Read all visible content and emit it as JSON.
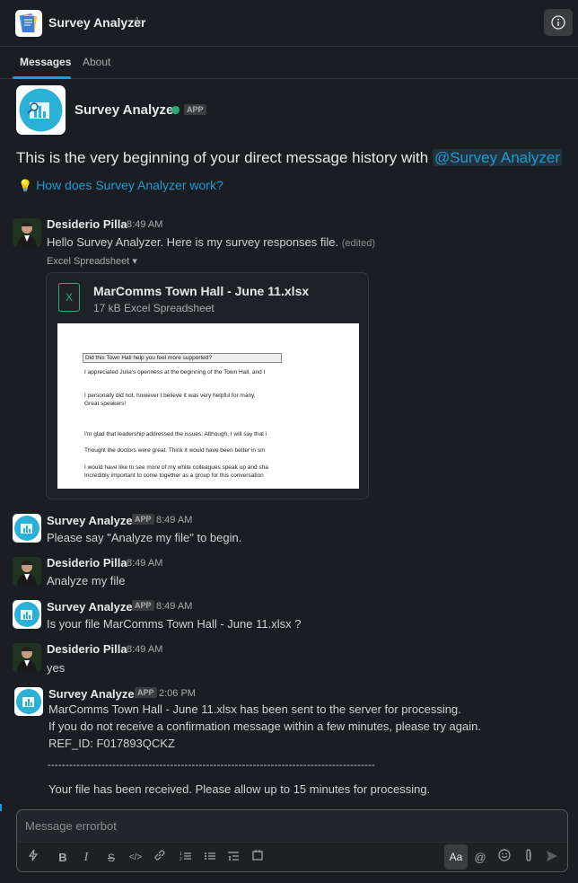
{
  "header": {
    "title": "Survey Analyzer",
    "star_icon": "star-icon",
    "info_icon": "info-icon"
  },
  "tabs": [
    {
      "label": "Messages",
      "active": true
    },
    {
      "label": "About",
      "active": false
    }
  ],
  "intro": {
    "name": "Survey Analyzer",
    "badge": "APP",
    "text_prefix": "This is the very beginning of your direct message history with ",
    "mention": "@Survey Analyzer",
    "howto": "How does Survey Analyzer work?"
  },
  "messages": [
    {
      "author": "Desiderio Pilla",
      "time": "8:49 AM",
      "text": "Hello Survey Analyzer. Here is my survey responses file.",
      "edited": "(edited)",
      "attachment_label": "Excel Spreadsheet",
      "file": {
        "name": "MarComms Town Hall - June 11.xlsx",
        "meta": "17 kB Excel Spreadsheet",
        "icon_letter": "X",
        "preview_rows": [
          "Did this Town Hall help you feel more supported?",
          "I appreciated Julia's openness at the beginning of the Town Hall, and I",
          "I personally did not, however I believe it was very helpful for many.",
          "Great speakers!",
          "I'm glad that leadership addressed the issues. Although, I will say that i",
          "Thought the doctors were great.  Think it would have been better in sm",
          "I would have like to see more of my white colleagues speak up and sha",
          "Incredibly important to come together as a group for this conversation"
        ]
      }
    },
    {
      "author": "Survey Analyzer",
      "badge": "APP",
      "time": "8:49 AM",
      "text": "Please say \"Analyze my file\" to begin."
    },
    {
      "author": "Desiderio Pilla",
      "time": "8:49 AM",
      "text": "Analyze my file"
    },
    {
      "author": "Survey Analyzer",
      "badge": "APP",
      "time": "8:49 AM",
      "text": "Is your file MarComms Town Hall - June 11.xlsx ?"
    },
    {
      "author": "Desiderio Pilla",
      "time": "8:49 AM",
      "text": "yes"
    },
    {
      "author": "Survey Analyzer",
      "badge": "APP",
      "time": "2:06 PM",
      "lines": [
        "MarComms Town Hall - June 11.xlsx has been sent to the server for processing.",
        "If you do not receive a confirmation message within a few minutes, please try again.",
        "REF_ID: F017893QCKZ"
      ],
      "divider": "-------------------------------------------------------------------------------------------",
      "final": "Your file has been received. Please allow up to 15 minutes for processing."
    }
  ],
  "composer": {
    "placeholder": "Message errorbot",
    "format_button": "Aa",
    "tools": [
      "shortcuts-icon",
      "bold-icon",
      "italic-icon",
      "strikethrough-icon",
      "code-icon",
      "link-icon",
      "ordered-list-icon",
      "bulleted-list-icon",
      "blockquote-icon",
      "code-block-icon",
      "mention-icon",
      "emoji-icon",
      "attach-icon",
      "send-icon"
    ]
  }
}
